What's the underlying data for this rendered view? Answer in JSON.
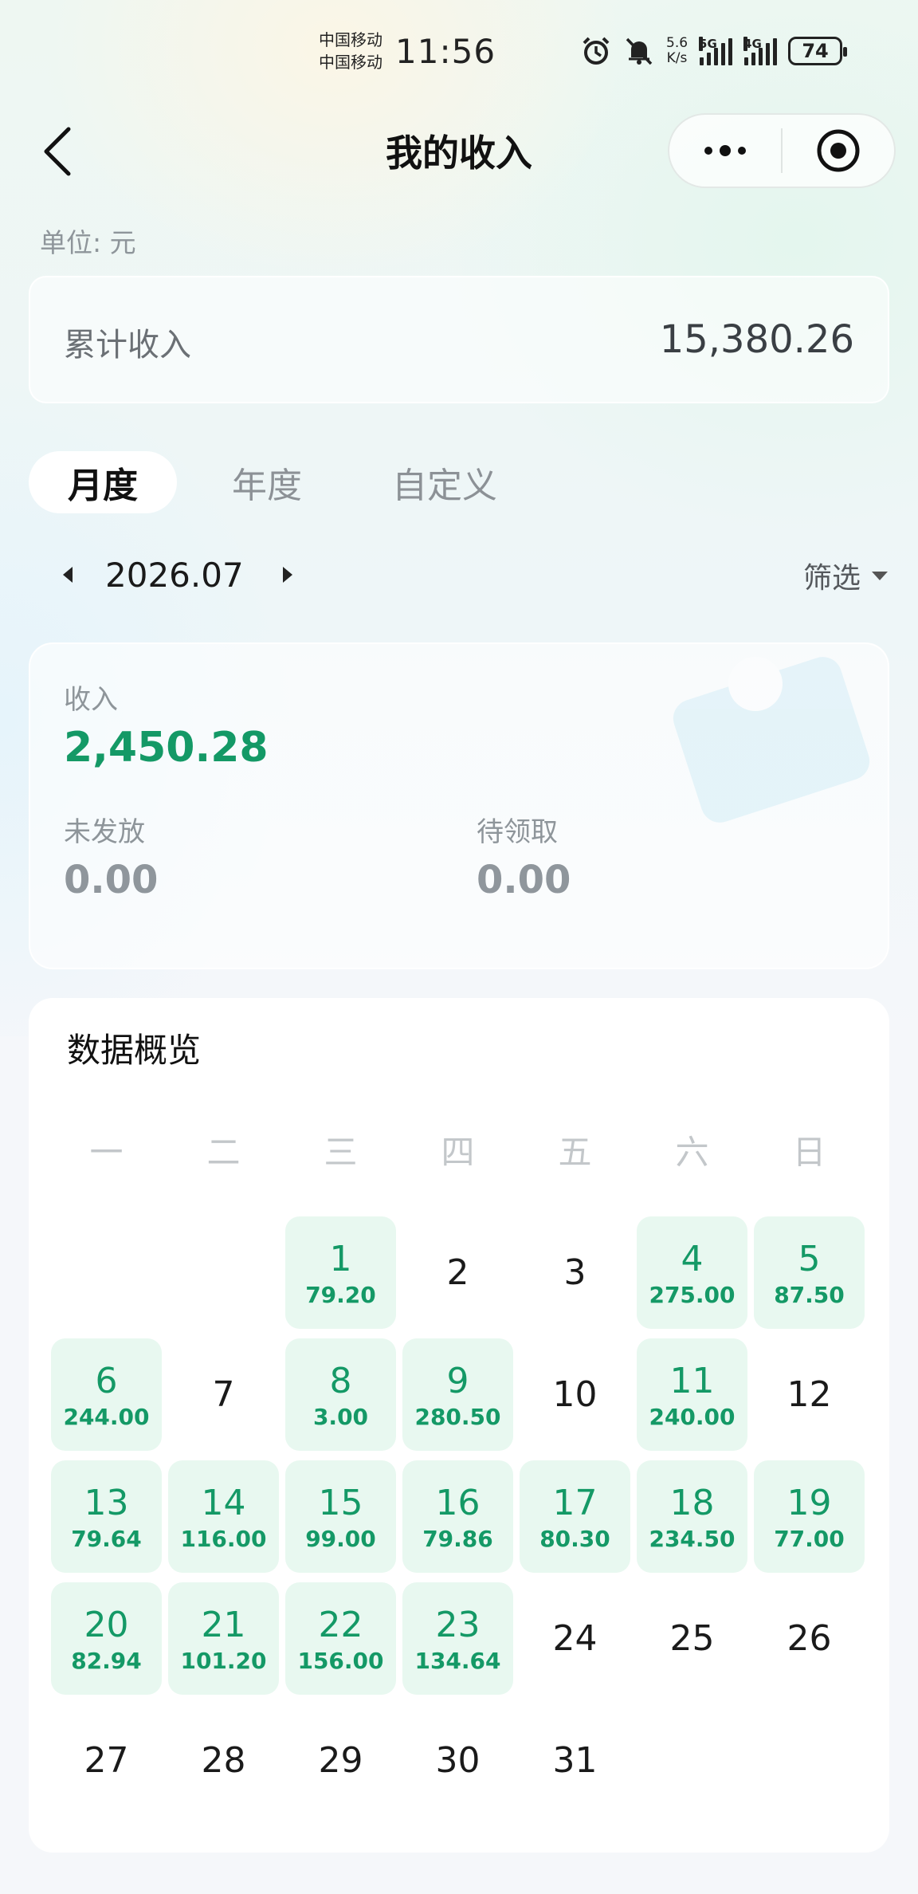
{
  "status_bar": {
    "carrier_1": "中国移动",
    "carrier_2": "中国移动",
    "time": "11:56",
    "net_speed_value": "5.6",
    "net_speed_unit": "K/s",
    "sig1_tag": "5G",
    "sig2_tag": "4G",
    "battery": "74",
    "icons": [
      "alarm-icon",
      "mute-icon",
      "signal-icon",
      "battery-icon"
    ]
  },
  "header": {
    "title": "我的收入",
    "icons": [
      "back-arrow-icon",
      "more-dots-icon",
      "target-icon"
    ]
  },
  "unit_label": "单位: 元",
  "total": {
    "label": "累计收入",
    "value": "15,380.26"
  },
  "tabs": [
    {
      "label": "月度",
      "active": true
    },
    {
      "label": "年度",
      "active": false
    },
    {
      "label": "自定义",
      "active": false
    }
  ],
  "month_nav": {
    "month": "2026.07",
    "filter_label": "筛选"
  },
  "income": {
    "label": "收入",
    "value": "2,450.28",
    "unpaid_label": "未发放",
    "unpaid_value": "0.00",
    "pending_label": "待领取",
    "pending_value": "0.00"
  },
  "overview": {
    "title": "数据概览",
    "weekdays": [
      "一",
      "二",
      "三",
      "四",
      "五",
      "六",
      "日"
    ],
    "leading_blanks": 2,
    "days": [
      {
        "day": "1",
        "amount": "79.20"
      },
      {
        "day": "2",
        "amount": ""
      },
      {
        "day": "3",
        "amount": ""
      },
      {
        "day": "4",
        "amount": "275.00"
      },
      {
        "day": "5",
        "amount": "87.50"
      },
      {
        "day": "6",
        "amount": "244.00"
      },
      {
        "day": "7",
        "amount": ""
      },
      {
        "day": "8",
        "amount": "3.00"
      },
      {
        "day": "9",
        "amount": "280.50"
      },
      {
        "day": "10",
        "amount": ""
      },
      {
        "day": "11",
        "amount": "240.00"
      },
      {
        "day": "12",
        "amount": ""
      },
      {
        "day": "13",
        "amount": "79.64"
      },
      {
        "day": "14",
        "amount": "116.00"
      },
      {
        "day": "15",
        "amount": "99.00"
      },
      {
        "day": "16",
        "amount": "79.86"
      },
      {
        "day": "17",
        "amount": "80.30"
      },
      {
        "day": "18",
        "amount": "234.50"
      },
      {
        "day": "19",
        "amount": "77.00"
      },
      {
        "day": "20",
        "amount": "82.94"
      },
      {
        "day": "21",
        "amount": "101.20"
      },
      {
        "day": "22",
        "amount": "156.00"
      },
      {
        "day": "23",
        "amount": "134.64"
      },
      {
        "day": "24",
        "amount": ""
      },
      {
        "day": "25",
        "amount": ""
      },
      {
        "day": "26",
        "amount": ""
      },
      {
        "day": "27",
        "amount": ""
      },
      {
        "day": "28",
        "amount": ""
      },
      {
        "day": "29",
        "amount": ""
      },
      {
        "day": "30",
        "amount": ""
      },
      {
        "day": "31",
        "amount": ""
      }
    ]
  },
  "colors": {
    "accent_green": "#149966",
    "cell_highlight": "#e8f8f0",
    "muted_gray": "#8f969c"
  }
}
